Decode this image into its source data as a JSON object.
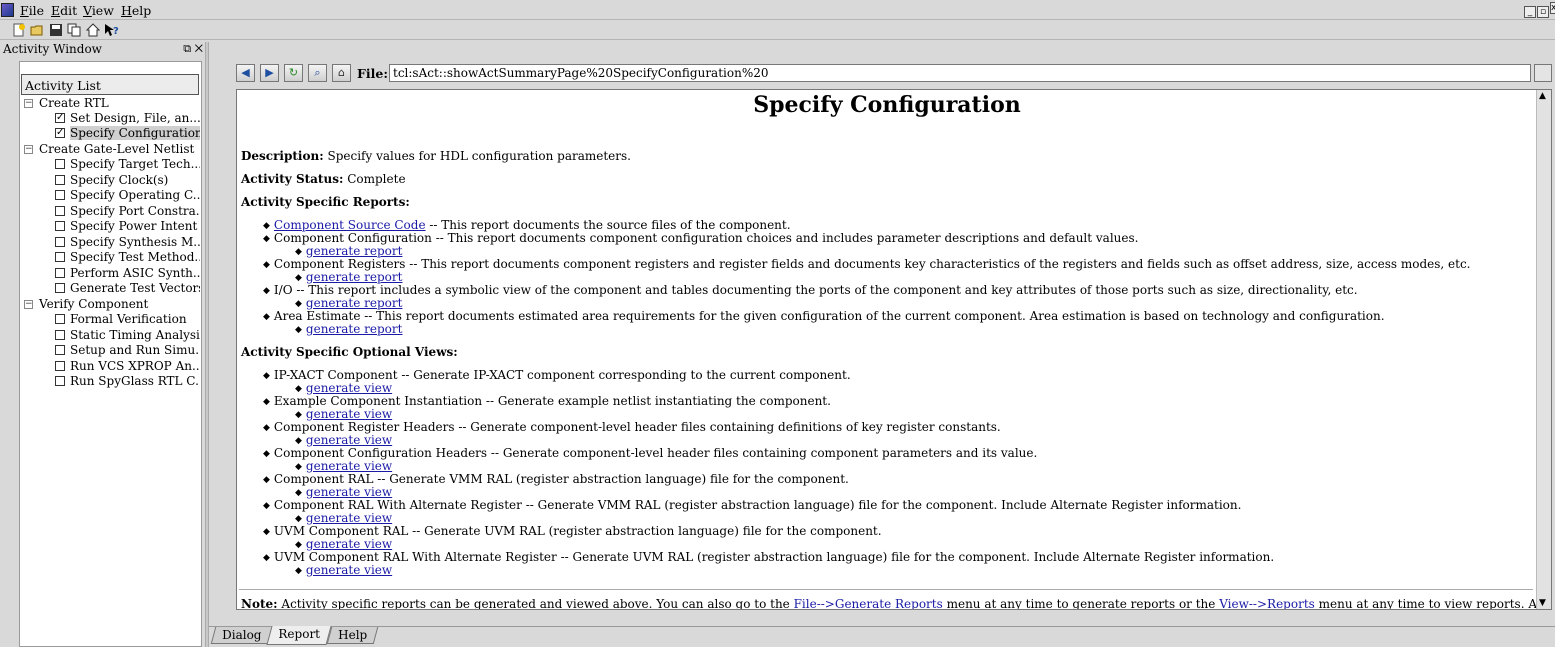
{
  "menubar": {
    "items": [
      {
        "mnemonic": "F",
        "rest": "ile"
      },
      {
        "mnemonic": "E",
        "rest": "dit"
      },
      {
        "mnemonic": "V",
        "rest": "iew"
      },
      {
        "mnemonic": "H",
        "rest": "elp"
      }
    ]
  },
  "toolbar": {
    "icons": [
      "new-icon",
      "open-icon",
      "save-icon",
      "copy-icon",
      "home-icon",
      "whats-this-icon"
    ]
  },
  "activity": {
    "window_title": "Activity Window",
    "list_header": "Activity List",
    "groups": [
      {
        "label": "Create RTL",
        "items": [
          {
            "label": "Set Design, File, an...",
            "checked": true
          },
          {
            "label": "Specify Configuration",
            "checked": true,
            "selected": true
          }
        ]
      },
      {
        "label": "Create Gate-Level Netlist",
        "items": [
          {
            "label": "Specify Target Tech...",
            "checked": false
          },
          {
            "label": "Specify Clock(s)",
            "checked": false
          },
          {
            "label": "Specify Operating C...",
            "checked": false
          },
          {
            "label": "Specify Port Constra...",
            "checked": false
          },
          {
            "label": "Specify Power Intent",
            "checked": false
          },
          {
            "label": "Specify Synthesis M...",
            "checked": false
          },
          {
            "label": "Specify Test Method...",
            "checked": false
          },
          {
            "label": "Perform ASIC Synth...",
            "checked": false
          },
          {
            "label": "Generate Test Vectors",
            "checked": false
          }
        ]
      },
      {
        "label": "Verify Component",
        "items": [
          {
            "label": "Formal Verification",
            "checked": false
          },
          {
            "label": "Static Timing Analysis",
            "checked": false
          },
          {
            "label": "Setup and Run Simu...",
            "checked": false
          },
          {
            "label": "Run VCS XPROP An...",
            "checked": false
          },
          {
            "label": "Run SpyGlass RTL C...",
            "checked": false
          }
        ]
      }
    ]
  },
  "report": {
    "file_label": "File:",
    "file_value": "tcl:sAct::showActSummaryPage%20SpecifyConfiguration%20",
    "title": "Specify Configuration",
    "description_label": "Description:",
    "description": "Specify values for HDL configuration parameters.",
    "status_label": "Activity Status:",
    "status": "Complete",
    "reports_heading": "Activity Specific Reports:",
    "reports": [
      {
        "name": "Component Source Code",
        "is_link": true,
        "desc": " -- This report documents the source files of the component.",
        "action": ""
      },
      {
        "name": "Component Configuration",
        "is_link": false,
        "desc": " -- This report documents component configuration choices and includes parameter descriptions and default values.",
        "action": "generate report"
      },
      {
        "name": "Component Registers",
        "is_link": false,
        "desc": " -- This report documents component registers and register fields and documents key characteristics of the registers and fields such as offset address, size, access modes, etc.",
        "action": "generate report"
      },
      {
        "name": "I/O",
        "is_link": false,
        "desc": " -- This report includes a symbolic view of the component and tables documenting the ports of the component and key attributes of those ports such as size, directionality, etc.",
        "action": "generate report"
      },
      {
        "name": "Area Estimate",
        "is_link": false,
        "desc": " -- This report documents estimated area requirements for the given configuration of the current component. Area estimation is based on technology and configuration.",
        "action": "generate report"
      }
    ],
    "views_heading": "Activity Specific Optional Views:",
    "views": [
      {
        "name": "IP-XACT Component",
        "desc": " -- Generate IP-XACT component corresponding to the current component.",
        "action": "generate view"
      },
      {
        "name": "Example Component Instantiation",
        "desc": " -- Generate example netlist instantiating the component.",
        "action": "generate view"
      },
      {
        "name": "Component Register Headers",
        "desc": " -- Generate component-level header files containing definitions of key register constants.",
        "action": "generate view"
      },
      {
        "name": "Component Configuration Headers",
        "desc": " -- Generate component-level header files containing component parameters and its value.",
        "action": "generate view"
      },
      {
        "name": "Component RAL",
        "desc": " -- Generate VMM RAL (register abstraction language) file for the component.",
        "action": "generate view"
      },
      {
        "name": "Component RAL With Alternate Register",
        "desc": " -- Generate VMM RAL (register abstraction language) file for the component. Include Alternate Register information.",
        "action": "generate view"
      },
      {
        "name": "UVM Component RAL",
        "desc": " -- Generate UVM RAL (register abstraction language) file for the component.",
        "action": "generate view"
      },
      {
        "name": "UVM Component RAL With Alternate Register",
        "desc": " -- Generate UVM RAL (register abstraction language) file for the component. Include Alternate Register information.",
        "action": "generate view"
      }
    ],
    "note_label": "Note:",
    "note_1": " Activity specific reports can be generated and viewed above. You can also go to the ",
    "note_link_1": "File-->Generate Reports",
    "note_2": " menu at any time to generate reports or the ",
    "note_link_2": "View-->Reports",
    "note_3": " menu at any time to view reports. Activity specific views"
  },
  "tabs": [
    {
      "label": "Dialog",
      "active": false
    },
    {
      "label": "Report",
      "active": true
    },
    {
      "label": "Help",
      "active": false
    }
  ]
}
